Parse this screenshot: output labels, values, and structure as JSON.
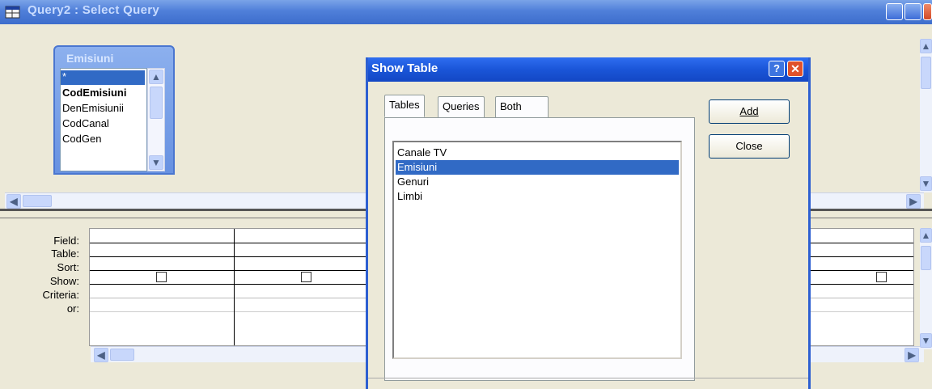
{
  "window": {
    "title": "Query2 : Select Query"
  },
  "table_widget": {
    "name": "Emisiuni",
    "fields": [
      "*",
      "CodEmisiuni",
      "DenEmisiunii",
      "CodCanal",
      "CodGen"
    ]
  },
  "grid": {
    "row_labels": [
      "Field:",
      "Table:",
      "Sort:",
      "Show:",
      "Criteria:",
      "or:"
    ]
  },
  "dialog": {
    "title": "Show Table",
    "tabs": [
      "Tables",
      "Queries",
      "Both"
    ],
    "active_tab": "Tables",
    "tables": [
      "Canale TV",
      "Emisiuni",
      "Genuri",
      "Limbi"
    ],
    "selected_table": "Emisiuni",
    "add_label": "Add",
    "close_label": "Close"
  },
  "icons": {
    "scroll_left": "◀",
    "scroll_right": "▶",
    "scroll_up": "▲",
    "scroll_down": "▼"
  }
}
